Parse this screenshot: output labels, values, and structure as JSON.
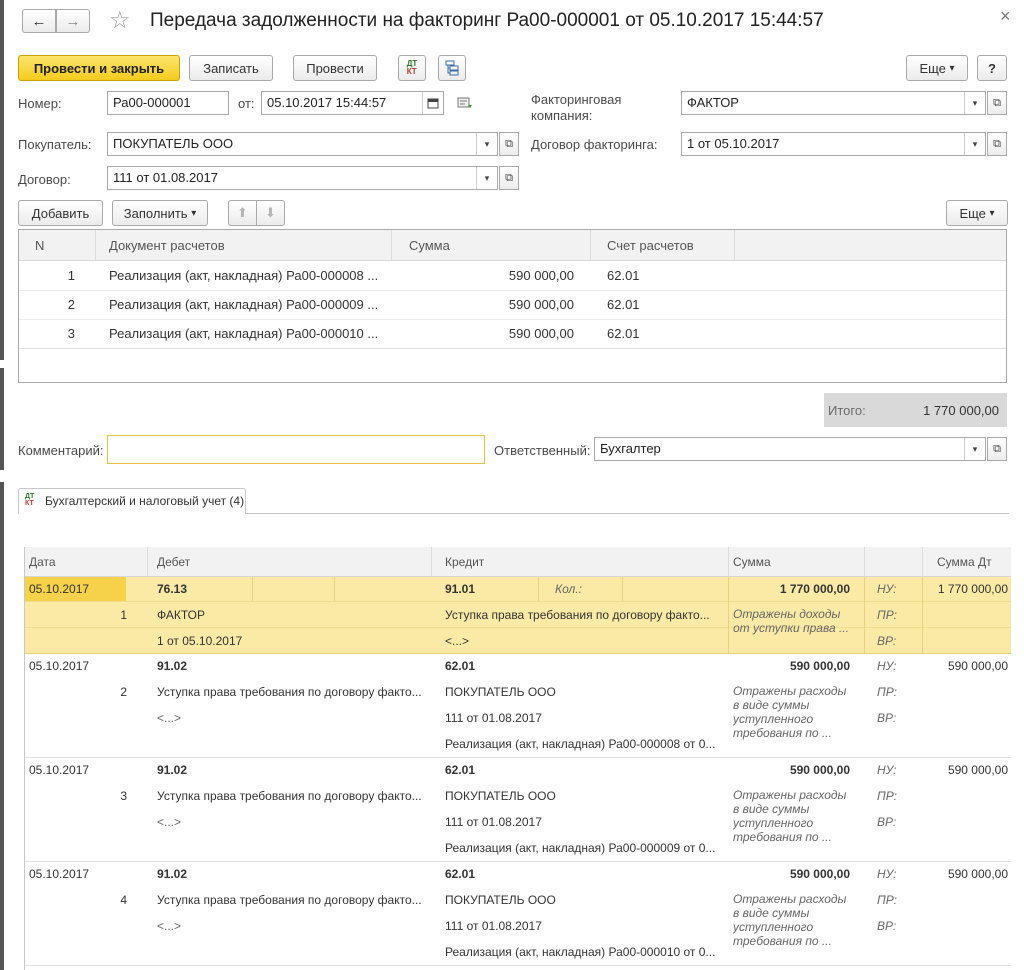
{
  "window": {
    "title": "Передача задолженности на факторинг Ра00-000001 от 05.10.2017 15:44:57",
    "back_glyph": "←",
    "forward_glyph": "→",
    "star_glyph": "☆",
    "close_glyph": "×"
  },
  "toolbar": {
    "post_close": "Провести и закрыть",
    "save": "Записать",
    "post": "Провести",
    "dtkt_top": "ДТ",
    "dtkt_bottom": "КТ",
    "more": "Еще",
    "more_arrow": "▾",
    "help": "?"
  },
  "form": {
    "number_label": "Номер:",
    "number_value": "Ра00-000001",
    "date_label": "от:",
    "date_value": "05.10.2017 15:44:57",
    "factoring_company_label_1": "Факторинговая",
    "factoring_company_label_2": "компания:",
    "factoring_company_value": "ФАКТОР",
    "buyer_label": "Покупатель:",
    "buyer_value": "ПОКУПАТЕЛЬ ООО",
    "factoring_contract_label": "Договор факторинга:",
    "factoring_contract_value": "1 от 05.10.2017",
    "contract_label": "Договор:",
    "contract_value": "111 от 01.08.2017",
    "dropdown_glyph": "▾",
    "open_glyph": "⧉"
  },
  "table_toolbar": {
    "add": "Добавить",
    "fill": "Заполнить",
    "up": "⬆",
    "down": "⬇",
    "more": "Еще"
  },
  "table": {
    "headers": [
      "N",
      "Документ расчетов",
      "Сумма",
      "Счет расчетов"
    ],
    "rows": [
      {
        "n": "1",
        "doc": "Реализация (акт, накладная) Ра00-000008 ...",
        "sum": "590 000,00",
        "account": "62.01"
      },
      {
        "n": "2",
        "doc": "Реализация (акт, накладная) Ра00-000009 ...",
        "sum": "590 000,00",
        "account": "62.01"
      },
      {
        "n": "3",
        "doc": "Реализация (акт, накладная) Ра00-000010 ...",
        "sum": "590 000,00",
        "account": "62.01"
      }
    ]
  },
  "total": {
    "label": "Итого:",
    "value": "1 770 000,00"
  },
  "comment_label": "Комментарий:",
  "comment_value": "",
  "responsible_label": "Ответственный:",
  "responsible_value": "Бухгалтер",
  "postings_tab": {
    "label": "Бухгалтерский и налоговый учет (4)"
  },
  "postings": {
    "headers": [
      "Дата",
      "Дебет",
      "Кредит",
      "Сумма",
      "Сумма Дт"
    ],
    "entries": [
      {
        "date": "05.10.2017",
        "n": "1",
        "debit_account": "76.13",
        "debit_sub1": "ФАКТОР",
        "debit_sub2": "1 от 05.10.2017",
        "credit_account": "91.01",
        "qty_label": "Кол.:",
        "credit_sub1": "Уступка права требования по договору факто...",
        "credit_sub2": "<...>",
        "credit_sub3": "",
        "sum": "1 770 000,00",
        "content": [
          "Отражены доходы",
          "от уступки права ..."
        ],
        "nu_label": "НУ:",
        "pr_label": "ПР:",
        "vr_label": "ВР:",
        "sum_dt": "1 770 000,00"
      },
      {
        "date": "05.10.2017",
        "n": "2",
        "debit_account": "91.02",
        "debit_sub1": "Уступка права требования по договору факто...",
        "debit_sub2": "<...>",
        "credit_account": "62.01",
        "qty_label": "",
        "credit_sub1": "ПОКУПАТЕЛЬ ООО",
        "credit_sub2": "111 от 01.08.2017",
        "credit_sub3": "Реализация (акт, накладная) Ра00-000008 от 0...",
        "sum": "590 000,00",
        "content": [
          "Отражены расходы",
          "в виде суммы",
          "уступленного",
          "требования по ..."
        ],
        "nu_label": "НУ:",
        "pr_label": "ПР:",
        "vr_label": "ВР:",
        "sum_dt": "590 000,00"
      },
      {
        "date": "05.10.2017",
        "n": "3",
        "debit_account": "91.02",
        "debit_sub1": "Уступка права требования по договору факто...",
        "debit_sub2": "<...>",
        "credit_account": "62.01",
        "qty_label": "",
        "credit_sub1": "ПОКУПАТЕЛЬ ООО",
        "credit_sub2": "111 от 01.08.2017",
        "credit_sub3": "Реализация (акт, накладная) Ра00-000009 от 0...",
        "sum": "590 000,00",
        "content": [
          "Отражены расходы",
          "в виде суммы",
          "уступленного",
          "требования по ..."
        ],
        "nu_label": "НУ:",
        "pr_label": "ПР:",
        "vr_label": "ВР:",
        "sum_dt": "590 000,00"
      },
      {
        "date": "05.10.2017",
        "n": "4",
        "debit_account": "91.02",
        "debit_sub1": "Уступка права требования по договору факто...",
        "debit_sub2": "<...>",
        "credit_account": "62.01",
        "qty_label": "",
        "credit_sub1": "ПОКУПАТЕЛЬ ООО",
        "credit_sub2": "111 от 01.08.2017",
        "credit_sub3": "Реализация (акт, накладная) Ра00-000010 от 0...",
        "sum": "590 000,00",
        "content": [
          "Отражены расходы",
          "в виде суммы",
          "уступленного",
          "требования по ..."
        ],
        "nu_label": "НУ:",
        "pr_label": "ПР:",
        "vr_label": "ВР:",
        "sum_dt": "590 000,00"
      }
    ]
  },
  "colors": {
    "primary_button": "#f4cb1e",
    "selected_row": "#fbeaa5",
    "selected_cell": "#f6d24a",
    "total_bar": "#d9d9d9",
    "comment_border": "#e8c13a"
  }
}
